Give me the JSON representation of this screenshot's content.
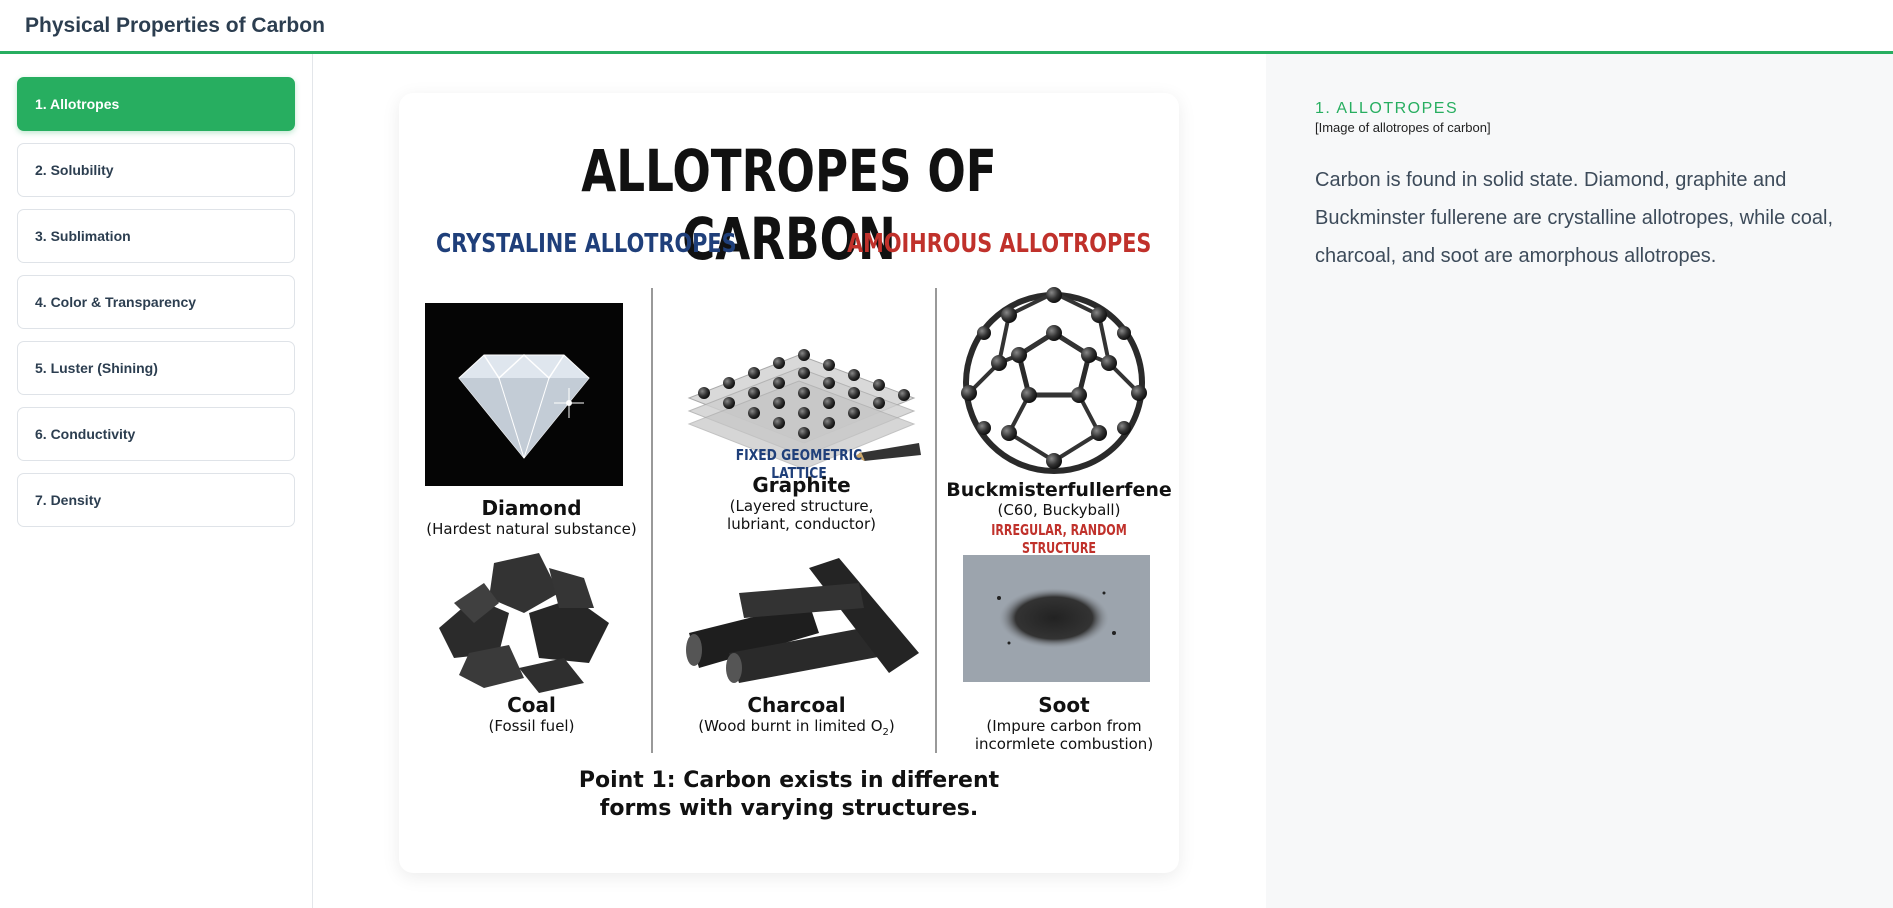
{
  "app": {
    "title": "Physical Properties of Carbon"
  },
  "nav": [
    {
      "label": "1. Allotropes",
      "active": true
    },
    {
      "label": "2. Solubility",
      "active": false
    },
    {
      "label": "3. Sublimation",
      "active": false
    },
    {
      "label": "4. Color & Transparency",
      "active": false
    },
    {
      "label": "5. Luster (Shining)",
      "active": false
    },
    {
      "label": "6. Conductivity",
      "active": false
    },
    {
      "label": "7. Density",
      "active": false
    }
  ],
  "infographic": {
    "title": "ALLOTROPES OF CARBON",
    "left_heading": "CRYSTALINE ALLOTROPES",
    "right_heading": "AMOIHROUS ALLOTROPES",
    "lattice_tag": "FIXED GEOMETRIC LATTICE",
    "irregular_tag": "IRREGULAR, RANDOM STRUCTURE",
    "items": {
      "diamond": {
        "name": "Diamond",
        "desc": "(Hardest natural substance)"
      },
      "graphite": {
        "name": "Graphite",
        "desc1": "(Layered structure,",
        "desc2": "lubriant, conductor)"
      },
      "bucky": {
        "name": "Buckmisterfullerfene",
        "desc": "(C60, Buckyball)"
      },
      "coal": {
        "name": "Coal",
        "desc": "(Fossil fuel)"
      },
      "charcoal": {
        "name": "Charcoal",
        "desc": "(Wood burnt in limited O",
        "subscript": "2",
        "desc_end": ")"
      },
      "soot": {
        "name": "Soot",
        "desc1": "(Impure carbon from",
        "desc2": "incormlete combustion)"
      }
    },
    "point_line1": "Point 1: Carbon exists in different",
    "point_line2": "forms with varying structures."
  },
  "detail": {
    "section_label": "1. ALLOTROPES",
    "image_caption": "[Image of allotropes of carbon]",
    "body": "Carbon is found in solid state. Diamond, graphite and Buckminster fullerene are crystalline allotropes, while coal, charcoal, and soot are amorphous allotropes."
  },
  "colors": {
    "accent": "#27ae60",
    "text": "#2c3e50",
    "crystal_blue": "#1f3f7a",
    "amorph_red": "#c0312b"
  }
}
